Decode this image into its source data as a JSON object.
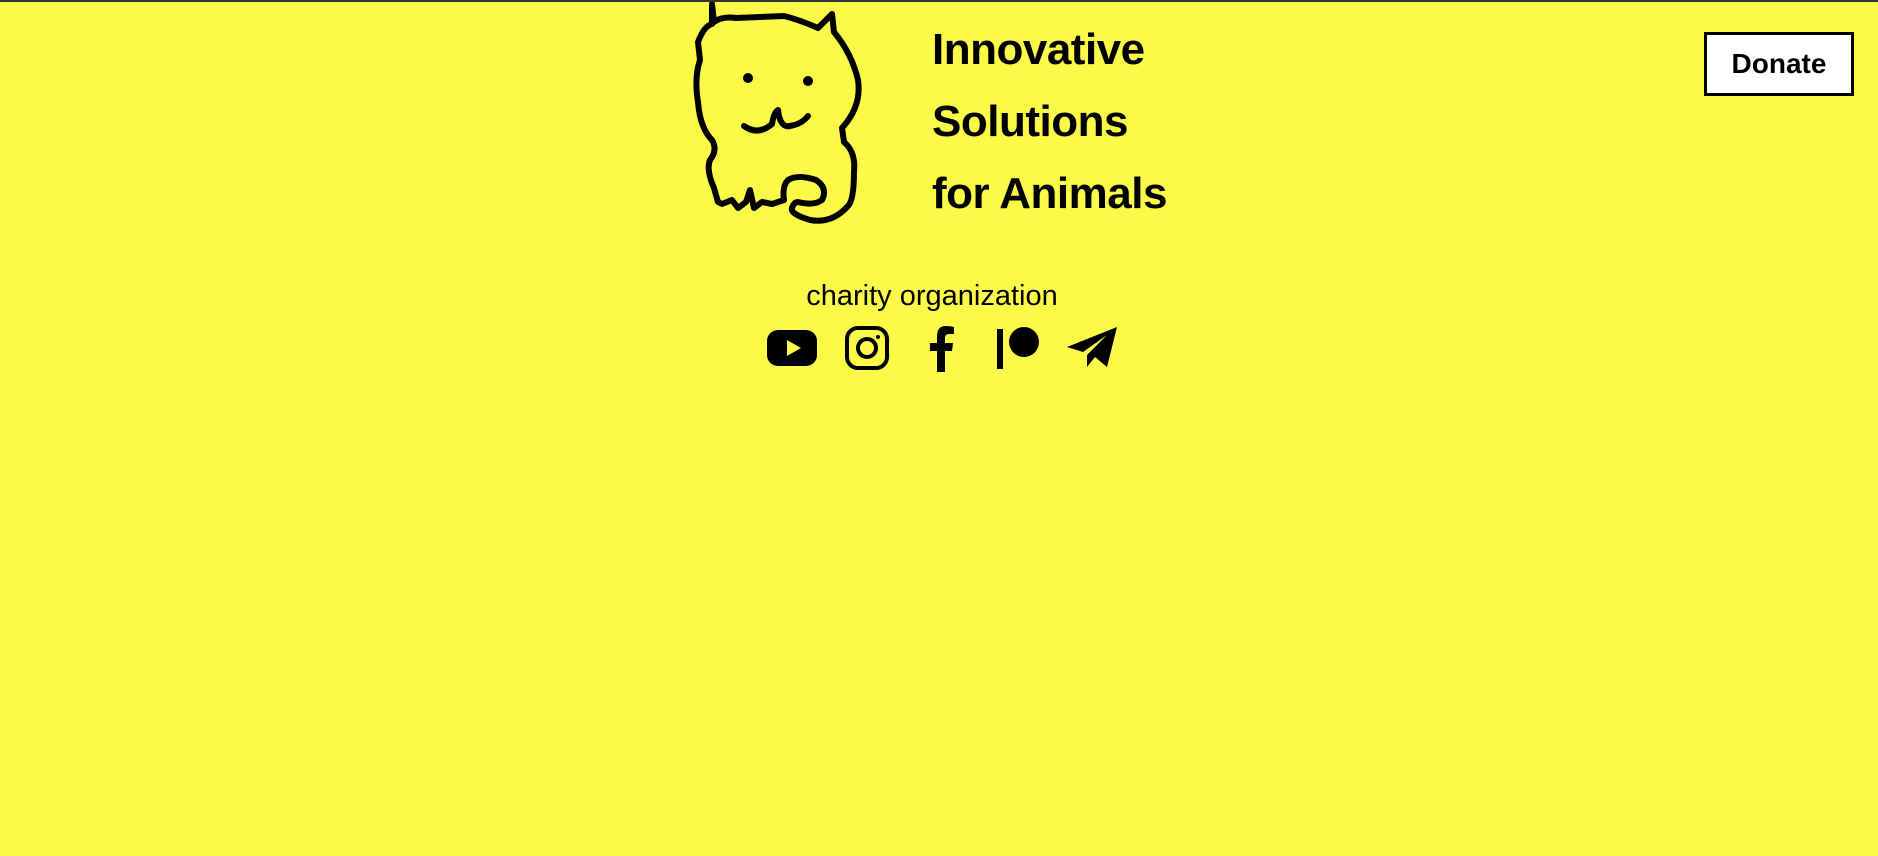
{
  "header": {
    "title_lines": [
      "Innovative",
      "Solutions",
      "for Animals"
    ],
    "donate_label": "Donate"
  },
  "logo": {
    "icon": "cat-doodle-icon"
  },
  "main": {
    "subtitle": "charity organization"
  },
  "social": {
    "items": [
      {
        "icon": "youtube-icon"
      },
      {
        "icon": "instagram-icon"
      },
      {
        "icon": "facebook-icon"
      },
      {
        "icon": "patreon-icon"
      },
      {
        "icon": "telegram-icon"
      }
    ]
  },
  "colors": {
    "background": "#FCFA48",
    "foreground": "#000000",
    "button_bg": "#FFFFFF"
  }
}
